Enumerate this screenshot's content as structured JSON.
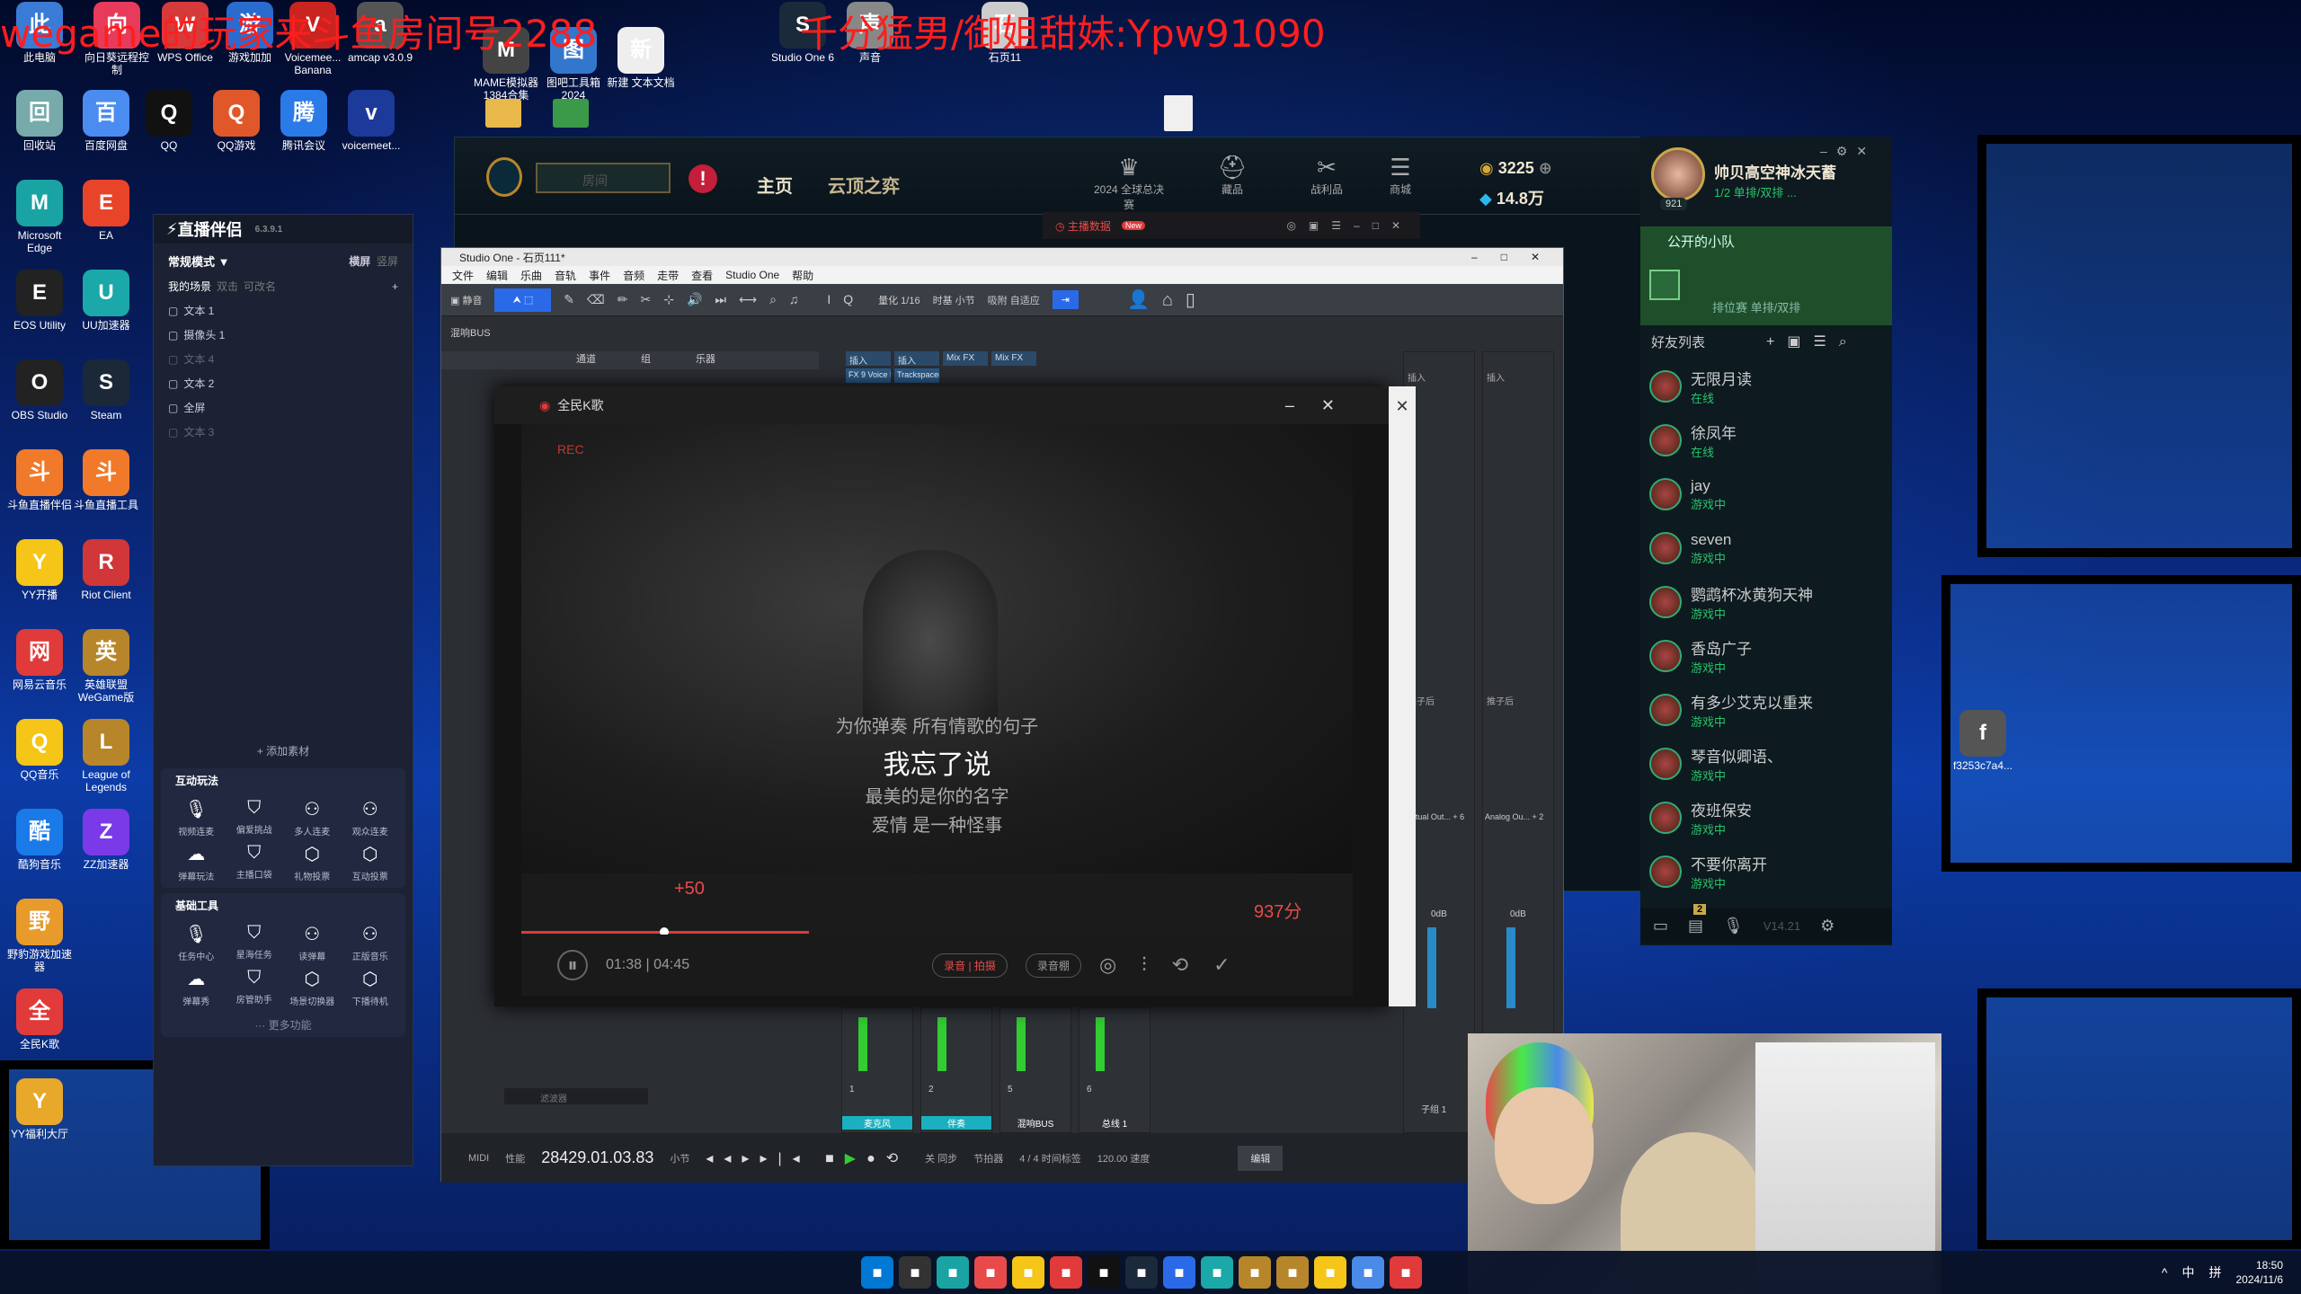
{
  "overlay": {
    "left_title": "wegame的玩家来斗鱼房间号2288",
    "right_title": "千分猛男/御姐甜妹:Ypw91090"
  },
  "desktop_icons": [
    {
      "label": "此电脑",
      "icon": "computer-icon",
      "color": "#3a7bd5"
    },
    {
      "label": "向日葵远程控制",
      "icon": "sunflower-icon",
      "color": "#e83a5b"
    },
    {
      "label": "WPS Office",
      "icon": "wps-icon",
      "color": "#d63a3a"
    },
    {
      "label": "游戏加加",
      "icon": "gamepad-icon",
      "color": "#2a6bd0"
    },
    {
      "label": "Voicemee... Banana",
      "icon": "voicemeeter-icon",
      "color": "#c9241f"
    },
    {
      "label": "amcap v3.0.9",
      "icon": "camera-icon",
      "color": "#555"
    },
    {
      "label": "MAME模拟器1384合集",
      "icon": "mame-icon",
      "color": "#444"
    },
    {
      "label": "图吧工具箱2024",
      "icon": "toolbox-icon",
      "color": "#3377cc"
    },
    {
      "label": "新建 文本文档",
      "icon": "text-file-icon",
      "color": "#eee"
    },
    {
      "label": "Studio One 6",
      "icon": "studio-one-icon",
      "color": "#1a2a3a"
    },
    {
      "label": "声音",
      "icon": "speaker-icon",
      "color": "#888"
    },
    {
      "label": "石页11",
      "icon": "file-icon",
      "color": "#ccc"
    },
    {
      "label": "回收站",
      "icon": "recycle-bin-icon",
      "color": "#7aa"
    },
    {
      "label": "百度网盘",
      "icon": "baidu-netdisk-icon",
      "color": "#4a8cf0"
    },
    {
      "label": "QQ",
      "icon": "qq-icon",
      "color": "#111"
    },
    {
      "label": "QQ游戏",
      "icon": "qq-game-icon",
      "color": "#e0582a"
    },
    {
      "label": "腾讯会议",
      "icon": "tencent-meeting-icon",
      "color": "#2a7ae8"
    },
    {
      "label": "voicemeet...",
      "icon": "voicemeeter-icon",
      "color": "#1c3a9a"
    },
    {
      "label": "Microsoft Edge",
      "icon": "edge-icon",
      "color": "#1aa3a3"
    },
    {
      "label": "EA",
      "icon": "ea-icon",
      "color": "#e8442a"
    },
    {
      "label": "EOS Utility",
      "icon": "eos-icon",
      "color": "#222"
    },
    {
      "label": "UU加速器",
      "icon": "uu-icon",
      "color": "#1aa8a8"
    },
    {
      "label": "OBS Studio",
      "icon": "obs-icon",
      "color": "#222"
    },
    {
      "label": "Steam",
      "icon": "steam-icon",
      "color": "#1b2838"
    },
    {
      "label": "斗鱼直播伴侣",
      "icon": "douyu-icon",
      "color": "#f07a2a"
    },
    {
      "label": "斗鱼直播工具",
      "icon": "douyu-tool-icon",
      "color": "#f07a2a"
    },
    {
      "label": "YY开播",
      "icon": "yy-icon",
      "color": "#f5c518"
    },
    {
      "label": "Riot Client",
      "icon": "riot-icon",
      "color": "#d13639"
    },
    {
      "label": "网易云音乐",
      "icon": "netease-music-icon",
      "color": "#e03a3a"
    },
    {
      "label": "英雄联盟WeGame版",
      "icon": "lol-wegame-icon",
      "color": "#b8862a"
    },
    {
      "label": "QQ音乐",
      "icon": "qq-music-icon",
      "color": "#f5c518"
    },
    {
      "label": "League of Legends",
      "icon": "lol-icon",
      "color": "#b8862a"
    },
    {
      "label": "酷狗音乐",
      "icon": "kugou-icon",
      "color": "#1a7ae8"
    },
    {
      "label": "ZZ加速器",
      "icon": "zz-icon",
      "color": "#7a3ae8"
    },
    {
      "label": "野豹游戏加速器",
      "icon": "leopard-icon",
      "color": "#e89a2a"
    },
    {
      "label": "全民K歌",
      "icon": "kge-icon",
      "color": "#e03a3a"
    },
    {
      "label": "YY福利大厅",
      "icon": "yy-welfare-icon",
      "color": "#e8a82a"
    },
    {
      "label": "f3253c7a4...",
      "icon": "image-file-icon",
      "color": "#555"
    }
  ],
  "zhibo": {
    "app_title": "直播伴侣",
    "version": "6.3.9.1",
    "mode": "常规模式 ▼",
    "orient": [
      "横屏",
      "竖屏"
    ],
    "scenes_tabs": [
      "我的场景",
      "双击",
      "可改名"
    ],
    "sources": [
      "文本 1",
      "摄像头 1",
      "文本 4",
      "文本 2",
      "全屏",
      "文本 3"
    ],
    "add_source": "+ 添加素材",
    "interactive_title": "互动玩法",
    "interactive": [
      "视频连麦",
      "偏爱挑战",
      "多人连麦",
      "观众连麦",
      "弹幕玩法",
      "主播口袋",
      "礼物投票",
      "互动投票"
    ],
    "tools_title": "基础工具",
    "tools": [
      "任务中心",
      "星海任务",
      "读弹幕",
      "正版音乐",
      "弹幕秀",
      "房管助手",
      "场景切换器",
      "下播待机"
    ],
    "more": "··· 更多功能"
  },
  "lol": {
    "room_placeholder": "房间",
    "nav": [
      "主页",
      "云顶之弈"
    ],
    "icons": [
      {
        "label": "2024 全球总决赛",
        "icon": "worlds-icon"
      },
      {
        "label": "藏品",
        "icon": "collection-icon"
      },
      {
        "label": "战利品",
        "icon": "loot-icon"
      },
      {
        "label": "商城",
        "icon": "store-icon"
      }
    ],
    "be": "3225",
    "rp": "14.8万",
    "player_name": "帅贝高空神冰天蓄",
    "player_level": "921",
    "player_status": "1/2 单排/双排 ...",
    "party_title": "公开的小队",
    "party_sub": "排位赛 单排/双排",
    "friends_title": "好友列表",
    "friends": [
      {
        "name": "无限月读",
        "status": "在线"
      },
      {
        "name": "徐凤年",
        "status": "在线"
      },
      {
        "name": "jay",
        "status": "游戏中"
      },
      {
        "name": "seven",
        "status": "游戏中"
      },
      {
        "name": "鹦鹉杯冰黄狗天神",
        "status": "游戏中"
      },
      {
        "name": "香岛广子",
        "status": "游戏中"
      },
      {
        "name": "有多少艾克以重来",
        "status": "游戏中"
      },
      {
        "name": "琴音似卿语、",
        "status": "游戏中"
      },
      {
        "name": "夜班保安",
        "status": "游戏中"
      },
      {
        "name": "不要你离开",
        "status": "游戏中"
      }
    ],
    "version": "V14.21",
    "notif_count": "2",
    "mini_bar_label": "主播数据",
    "new_badge": "New"
  },
  "studio": {
    "title": "Studio One - 石页111*",
    "menu": [
      "文件",
      "编辑",
      "乐曲",
      "音轨",
      "事件",
      "音频",
      "走带",
      "查看",
      "Studio One",
      "帮助"
    ],
    "track_label": "静音",
    "bus": "混响BUS",
    "quantize": {
      "label": "量化",
      "value": "1/16"
    },
    "timebase": {
      "label": "时基",
      "value": "小节"
    },
    "snap": {
      "label": "吸附",
      "value": "自适应"
    },
    "cols": [
      "通道",
      "组",
      "乐器"
    ],
    "inserts": [
      "插入",
      "插入",
      "Mix FX",
      "Mix FX"
    ],
    "plugins": [
      "FX 9 Voice D...",
      "Trackspacer..."
    ],
    "channels": [
      {
        "n": "1",
        "name": "麦克风"
      },
      {
        "n": "2",
        "name": "伴奏"
      },
      {
        "n": "5",
        "name": "混响BUS"
      },
      {
        "n": "6",
        "name": "总线 1"
      }
    ],
    "right_ch": [
      {
        "name": "Virtual Out... + 6",
        "db": "0dB"
      },
      {
        "name": "Analog Ou... + 2",
        "db": "0dB"
      }
    ],
    "sends": [
      "插入",
      "插入"
    ],
    "post": [
      "推子后",
      "推子后"
    ],
    "sub": "子组 1",
    "filter_placeholder": "滤波器",
    "position": "28429.01.03.83",
    "pos_unit": "小节",
    "midi": "MIDI",
    "perf": "性能",
    "sig": "4 / 4",
    "sig_label": "时间标签",
    "tempo": "120.00",
    "tempo_label": "速度",
    "sync": "关",
    "sync_label": "同步",
    "metronome": "节拍器",
    "edit": "编辑"
  },
  "kge": {
    "title": "全民K歌",
    "rec": "REC",
    "lyrics": [
      "为你弹奏 所有情歌的句子",
      "我忘了说",
      "最美的是你的名字",
      "爱情 是一种怪事"
    ],
    "score_plus": "+50",
    "score": "937分",
    "time": "01:38 | 04:45",
    "btn_record": "录音 | 拍摄",
    "btn_booth": "录音棚"
  },
  "taskbar": {
    "time": "18:50",
    "date": "2024/11/6",
    "tray": [
      "拼",
      "中",
      "^"
    ],
    "apps": [
      "start-icon",
      "search-icon",
      "edge-icon",
      "game-icon",
      "yy-icon",
      "netease-music-icon",
      "qq-icon",
      "studio-one-icon",
      "window-icon",
      "uu-icon",
      "lol-icon",
      "lol-wegame-icon",
      "yy-icon",
      "chrome-icon",
      "kge-icon"
    ]
  }
}
